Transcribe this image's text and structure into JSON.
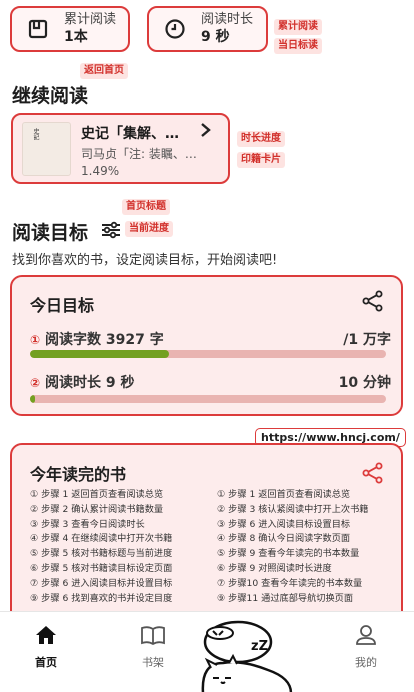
{
  "stats": [
    {
      "label": "累计阅读",
      "value": "1本",
      "icon": "book-square-icon"
    },
    {
      "label": "阅读时长",
      "value": "9 秒",
      "icon": "clock-icon"
    }
  ],
  "annotations": {
    "cumulative": "累计阅读",
    "today": "当日标读",
    "back_home": "返回首页",
    "duration_progress": "时长进度",
    "book_card": "印籍卡片",
    "home_title": "首页标题",
    "current_progress": "当前进度"
  },
  "continue": {
    "title": "继续阅读",
    "book_title": "史记「集解、…",
    "book_author": "司马贞「注: 装瞩、…",
    "progress": "1.49%",
    "cover_text": "史記"
  },
  "goal": {
    "title": "阅读目标",
    "subtitle": "找到你喜欢的书，设定阅读目标，开始阅读吧!"
  },
  "today": {
    "title": "今日目标",
    "words_label": "阅读字数 3927 字",
    "words_target": "/1 万字",
    "words_fraction": 0.39,
    "time_label": "阅读时长 9 秒",
    "time_target": "10 分钟",
    "time_fraction": 0.015
  },
  "url": "https://www.hncj.com/",
  "year": {
    "title": "今年读完的书",
    "steps_left": [
      "① 步骤 1  返回首页查看阅读总览",
      "② 步骤 2  确认累计阅读书籍数量",
      "③ 步骤 3  查看今日阅读时长",
      "④ 步骤 4  在继续阅读中打开次书籍",
      "⑤ 步骤 5  核对书籍标题与当前进度",
      "⑥ 步骤 5  核对书籍读目标设定页面",
      "⑦ 步骤 6  进入阅读目标并设置目标",
      "⑨ 步骤 6  找到喜欢的书并设定目度"
    ],
    "steps_right": [
      "① 步骤 1  返回首页查看阅读总览",
      "② 步骤 3  核认紧阅读中打开上次书籍",
      "③ 步骤 6  进入阅读目标设置目标",
      "④ 步骤 8  确认今日阅读字数页面",
      "⑤ 步骤 9  查看今年读完的书本数量",
      "⑥ 步骤 9  对照阅读时长进度",
      "⑦ 步骤10  查看今年读完的书本数量",
      "⑨ 步骤11  通过底部导航切换页面"
    ]
  },
  "nav": [
    {
      "label": "首页",
      "icon": "home-icon",
      "active": true
    },
    {
      "label": "书架",
      "icon": "bookshelf-icon",
      "active": false
    },
    {
      "label": "我的",
      "icon": "profile-icon",
      "active": false
    }
  ]
}
